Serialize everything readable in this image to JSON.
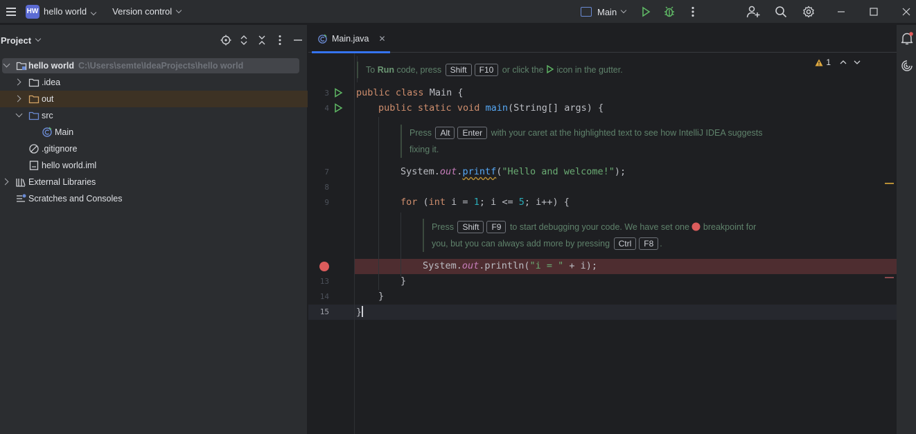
{
  "titlebar": {
    "project_badge": "HW",
    "project_name": "hello world",
    "version_control": "Version control",
    "run_config": "Main"
  },
  "project_panel": {
    "title": "Project",
    "tree": [
      {
        "label": "hello world",
        "path": "C:\\Users\\semte\\IdeaProjects\\hello world",
        "type": "module-folder",
        "expanded": true
      },
      {
        "label": ".idea",
        "type": "folder",
        "expanded": false
      },
      {
        "label": "out",
        "type": "folder-excluded",
        "expanded": false
      },
      {
        "label": "src",
        "type": "source-folder",
        "expanded": true
      },
      {
        "label": "Main",
        "type": "java-class"
      },
      {
        "label": ".gitignore",
        "type": "ignore-file"
      },
      {
        "label": "hello world.iml",
        "type": "iml-file"
      },
      {
        "label": "External Libraries",
        "type": "libraries",
        "expanded": false
      },
      {
        "label": "Scratches and Consoles",
        "type": "scratches"
      }
    ]
  },
  "editor": {
    "tab": {
      "label": "Main.java"
    },
    "warning_count": "1",
    "line_numbers": {
      "l3": "3",
      "l4": "4",
      "l7": "7",
      "l8": "8",
      "l9": "9",
      "l13": "13",
      "l14": "14",
      "l15": "15"
    },
    "hint1": {
      "t1": "To",
      "bold": "Run",
      "t2": "code, press",
      "k1": "Shift",
      "k2": "F10",
      "t3": "or click the",
      "t4": "icon in the gutter."
    },
    "hint2": {
      "t1": "Press",
      "k1": "Alt",
      "k2": "Enter",
      "t2": "with your caret at the highlighted text to see how IntelliJ IDEA suggests",
      "t3": "fixing it."
    },
    "hint3": {
      "t1": "Press",
      "k1": "Shift",
      "k2": "F9",
      "t2": "to start debugging your code. We have set one",
      "t3": "breakpoint for",
      "t4": "you, but you can always add more by pressing",
      "k3": "Ctrl",
      "k4": "F8",
      "t5": "."
    },
    "code": {
      "kw_public": "public",
      "kw_class": "class",
      "class_name": "Main",
      "brace_open": "{",
      "kw_static": "static",
      "kw_void": "void",
      "main_fn": "main",
      "main_args": "(String[] args) {",
      "system": "System.",
      "out": "out",
      "printf": "printf",
      "hello_str": "\"Hello and welcome!\"",
      "close_call": ");",
      "kw_for": "for",
      "for_open": " (",
      "kw_int": "int",
      "for_i": " i = ",
      "num1": "1",
      "for_mid": "; i <= ",
      "num5": "5",
      "for_end": "; i++) {",
      "println": ".println(",
      "i_str": "\"i = \"",
      "println_end": " + i);",
      "brace_close": "}"
    }
  }
}
